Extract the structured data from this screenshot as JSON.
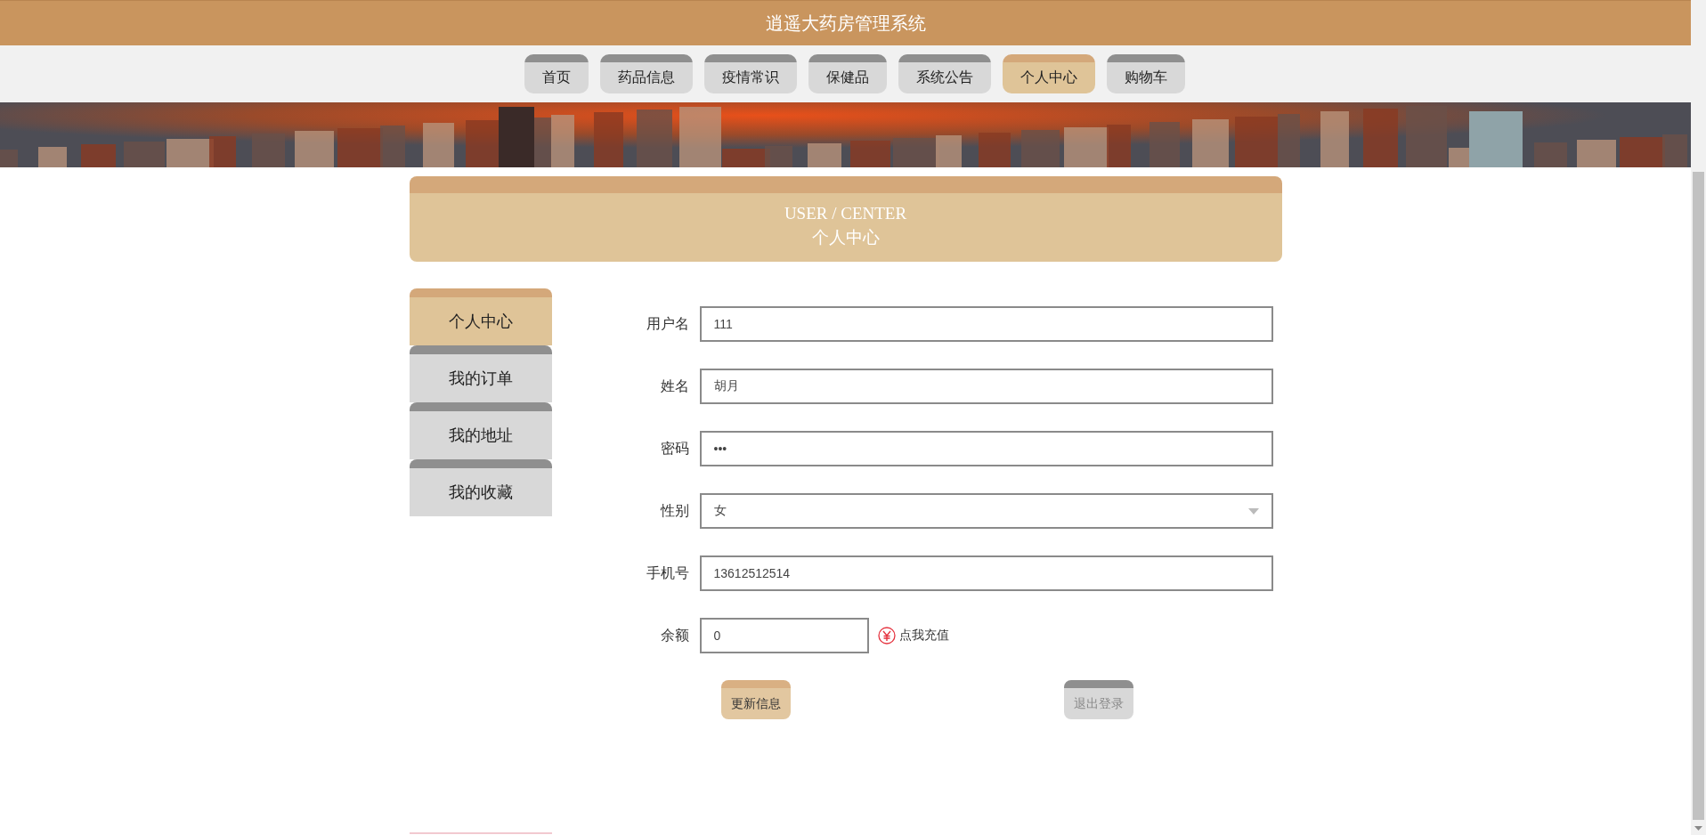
{
  "header": {
    "title": "逍遥大药房管理系统"
  },
  "nav": [
    {
      "label": "首页",
      "selected": false
    },
    {
      "label": "药品信息",
      "selected": false
    },
    {
      "label": "疫情常识",
      "selected": false
    },
    {
      "label": "保健品",
      "selected": false
    },
    {
      "label": "系统公告",
      "selected": false
    },
    {
      "label": "个人中心",
      "selected": true
    },
    {
      "label": "购物车",
      "selected": false
    }
  ],
  "section_heading": {
    "english": "USER / CENTER",
    "chinese": "个人中心"
  },
  "sidebar": [
    {
      "label": "个人中心",
      "selected": true
    },
    {
      "label": "我的订单",
      "selected": false
    },
    {
      "label": "我的地址",
      "selected": false
    },
    {
      "label": "我的收藏",
      "selected": false
    }
  ],
  "form": {
    "fields": [
      {
        "kind": "text",
        "label": "用户名",
        "value": "111"
      },
      {
        "kind": "text",
        "label": "姓名",
        "value": "胡月"
      },
      {
        "kind": "password",
        "label": "密码",
        "value": "•••"
      },
      {
        "kind": "select",
        "label": "性别",
        "value": "女"
      },
      {
        "kind": "text",
        "label": "手机号",
        "value": "13612512514"
      },
      {
        "kind": "balance",
        "label": "余额",
        "value": "0",
        "link": "点我充值"
      }
    ],
    "buttons": [
      {
        "label": "更新信息",
        "kind": "primary"
      },
      {
        "label": "退出登录",
        "kind": "secondary"
      }
    ]
  }
}
